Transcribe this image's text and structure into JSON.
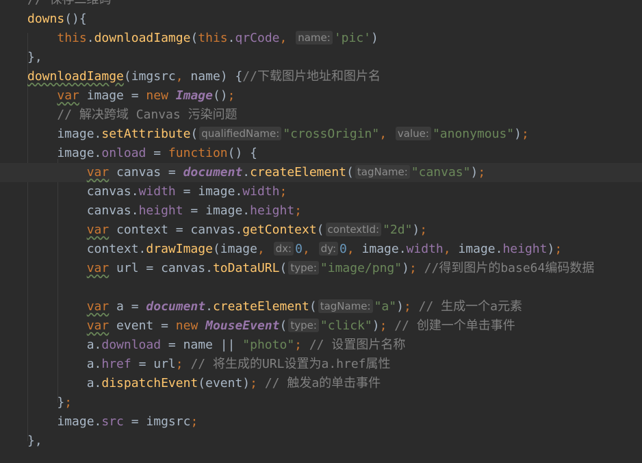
{
  "lines": [
    [
      {
        "c": "cmt",
        "t": "// 保存二维码"
      }
    ],
    [
      {
        "c": "fn",
        "t": "downs"
      },
      {
        "c": "",
        "t": "(){"
      }
    ],
    [
      {
        "c": "",
        "t": "    "
      },
      {
        "c": "kw",
        "t": "this"
      },
      {
        "c": "",
        "t": "."
      },
      {
        "c": "fn",
        "t": "downloadIamge"
      },
      {
        "c": "",
        "t": "("
      },
      {
        "c": "kw",
        "t": "this"
      },
      {
        "c": "",
        "t": "."
      },
      {
        "c": "prop",
        "t": "qrCode"
      },
      {
        "c": "kw",
        "t": ","
      },
      {
        "c": "",
        "t": " "
      },
      {
        "c": "hint",
        "t": "name:"
      },
      {
        "c": "str",
        "t": "'pic'"
      },
      {
        "c": "",
        "t": ")"
      }
    ],
    [
      {
        "c": "",
        "t": "},"
      }
    ],
    [
      {
        "c": "fn wavy",
        "t": "downloadIamge"
      },
      {
        "c": "",
        "t": "(imgsrc"
      },
      {
        "c": "kw",
        "t": ","
      },
      {
        "c": "",
        "t": " name) {"
      },
      {
        "c": "cmt",
        "t": "//"
      },
      {
        "c": "cmt cmt-cjk",
        "t": "下载图片地址和图片名"
      }
    ],
    [
      {
        "c": "",
        "t": "    "
      },
      {
        "c": "kw wavy",
        "t": "var"
      },
      {
        "c": "",
        "t": " image = "
      },
      {
        "c": "kw",
        "t": "new "
      },
      {
        "c": "cls",
        "t": "Image"
      },
      {
        "c": "",
        "t": "()"
      },
      {
        "c": "kw",
        "t": ";"
      }
    ],
    [
      {
        "c": "",
        "t": "    "
      },
      {
        "c": "cmt",
        "t": "// "
      },
      {
        "c": "cmt cmt-cjk",
        "t": "解决跨域"
      },
      {
        "c": "cmt",
        "t": " Canvas "
      },
      {
        "c": "cmt cmt-cjk",
        "t": "污染问题"
      }
    ],
    [
      {
        "c": "",
        "t": "    image."
      },
      {
        "c": "fn",
        "t": "setAttribute"
      },
      {
        "c": "",
        "t": "("
      },
      {
        "c": "hint",
        "t": "qualifiedName:"
      },
      {
        "c": "str",
        "t": "\"crossOrigin\""
      },
      {
        "c": "kw",
        "t": ","
      },
      {
        "c": "",
        "t": " "
      },
      {
        "c": "hint",
        "t": "value:"
      },
      {
        "c": "str",
        "t": "\"anonymous\""
      },
      {
        "c": "",
        "t": ")"
      },
      {
        "c": "kw",
        "t": ";"
      }
    ],
    [
      {
        "c": "",
        "t": "    image."
      },
      {
        "c": "prop",
        "t": "onload"
      },
      {
        "c": "",
        "t": " = "
      },
      {
        "c": "kw",
        "t": "function"
      },
      {
        "c": "",
        "t": "() {"
      }
    ],
    [
      {
        "c": "",
        "t": "        "
      },
      {
        "c": "kw wavy",
        "t": "var"
      },
      {
        "c": "",
        "t": " canvas = "
      },
      {
        "c": "cls",
        "t": "document"
      },
      {
        "c": "",
        "t": "."
      },
      {
        "c": "fn",
        "t": "createElement"
      },
      {
        "c": "",
        "t": "("
      },
      {
        "c": "hint",
        "t": "tagName:"
      },
      {
        "c": "str",
        "t": "\"canvas\""
      },
      {
        "c": "",
        "t": ")"
      },
      {
        "c": "kw",
        "t": ";"
      }
    ],
    [
      {
        "c": "",
        "t": "        canvas."
      },
      {
        "c": "prop",
        "t": "width"
      },
      {
        "c": "",
        "t": " = image."
      },
      {
        "c": "prop",
        "t": "width"
      },
      {
        "c": "kw",
        "t": ";"
      }
    ],
    [
      {
        "c": "",
        "t": "        canvas."
      },
      {
        "c": "prop",
        "t": "height"
      },
      {
        "c": "",
        "t": " = image."
      },
      {
        "c": "prop",
        "t": "height"
      },
      {
        "c": "kw",
        "t": ";"
      }
    ],
    [
      {
        "c": "",
        "t": "        "
      },
      {
        "c": "kw wavy",
        "t": "var"
      },
      {
        "c": "",
        "t": " context = canvas."
      },
      {
        "c": "fn",
        "t": "getContext"
      },
      {
        "c": "",
        "t": "("
      },
      {
        "c": "hint",
        "t": "contextId:"
      },
      {
        "c": "str",
        "t": "\"2d\""
      },
      {
        "c": "",
        "t": ")"
      },
      {
        "c": "kw",
        "t": ";"
      }
    ],
    [
      {
        "c": "",
        "t": "        context."
      },
      {
        "c": "fn",
        "t": "drawImage"
      },
      {
        "c": "",
        "t": "(image"
      },
      {
        "c": "kw",
        "t": ","
      },
      {
        "c": "",
        "t": " "
      },
      {
        "c": "hint",
        "t": "dx:"
      },
      {
        "c": "num",
        "t": "0"
      },
      {
        "c": "kw",
        "t": ","
      },
      {
        "c": "",
        "t": " "
      },
      {
        "c": "hint",
        "t": "dy:"
      },
      {
        "c": "num",
        "t": "0"
      },
      {
        "c": "kw",
        "t": ","
      },
      {
        "c": "",
        "t": " image."
      },
      {
        "c": "prop",
        "t": "width"
      },
      {
        "c": "kw",
        "t": ","
      },
      {
        "c": "",
        "t": " image."
      },
      {
        "c": "prop",
        "t": "height"
      },
      {
        "c": "",
        "t": ")"
      },
      {
        "c": "kw",
        "t": ";"
      }
    ],
    [
      {
        "c": "",
        "t": "        "
      },
      {
        "c": "kw wavy",
        "t": "var"
      },
      {
        "c": "",
        "t": " url = canvas."
      },
      {
        "c": "fn",
        "t": "toDataURL"
      },
      {
        "c": "",
        "t": "("
      },
      {
        "c": "hint",
        "t": "type:"
      },
      {
        "c": "str",
        "t": "\"image/png\""
      },
      {
        "c": "",
        "t": ")"
      },
      {
        "c": "kw",
        "t": ";"
      },
      {
        "c": "",
        "t": " "
      },
      {
        "c": "cmt",
        "t": "//"
      },
      {
        "c": "cmt cmt-cjk",
        "t": "得到图片的"
      },
      {
        "c": "cmt",
        "t": "base64"
      },
      {
        "c": "cmt cmt-cjk",
        "t": "编码数据"
      }
    ],
    [],
    [
      {
        "c": "",
        "t": "        "
      },
      {
        "c": "kw wavy",
        "t": "var"
      },
      {
        "c": "",
        "t": " a = "
      },
      {
        "c": "cls",
        "t": "document"
      },
      {
        "c": "",
        "t": "."
      },
      {
        "c": "fn",
        "t": "createElement"
      },
      {
        "c": "",
        "t": "("
      },
      {
        "c": "hint",
        "t": "tagName:"
      },
      {
        "c": "str",
        "t": "\"a\""
      },
      {
        "c": "",
        "t": ")"
      },
      {
        "c": "kw",
        "t": ";"
      },
      {
        "c": "",
        "t": " "
      },
      {
        "c": "cmt",
        "t": "// "
      },
      {
        "c": "cmt cmt-cjk",
        "t": "生成一个"
      },
      {
        "c": "cmt",
        "t": "a"
      },
      {
        "c": "cmt cmt-cjk",
        "t": "元素"
      }
    ],
    [
      {
        "c": "",
        "t": "        "
      },
      {
        "c": "kw wavy",
        "t": "var"
      },
      {
        "c": "",
        "t": " event = "
      },
      {
        "c": "kw",
        "t": "new "
      },
      {
        "c": "cls",
        "t": "MouseEvent"
      },
      {
        "c": "",
        "t": "("
      },
      {
        "c": "hint",
        "t": "type:"
      },
      {
        "c": "str",
        "t": "\"click\""
      },
      {
        "c": "",
        "t": ")"
      },
      {
        "c": "kw",
        "t": ";"
      },
      {
        "c": "",
        "t": " "
      },
      {
        "c": "cmt",
        "t": "// "
      },
      {
        "c": "cmt cmt-cjk",
        "t": "创建一个单击事件"
      }
    ],
    [
      {
        "c": "",
        "t": "        a."
      },
      {
        "c": "prop",
        "t": "download"
      },
      {
        "c": "",
        "t": " = name || "
      },
      {
        "c": "str",
        "t": "\"photo\""
      },
      {
        "c": "kw",
        "t": ";"
      },
      {
        "c": "",
        "t": " "
      },
      {
        "c": "cmt",
        "t": "// "
      },
      {
        "c": "cmt cmt-cjk",
        "t": "设置图片名称"
      }
    ],
    [
      {
        "c": "",
        "t": "        a."
      },
      {
        "c": "prop",
        "t": "href"
      },
      {
        "c": "",
        "t": " = url"
      },
      {
        "c": "kw",
        "t": ";"
      },
      {
        "c": "",
        "t": " "
      },
      {
        "c": "cmt",
        "t": "// "
      },
      {
        "c": "cmt cmt-cjk",
        "t": "将生成的"
      },
      {
        "c": "cmt",
        "t": "URL"
      },
      {
        "c": "cmt cmt-cjk",
        "t": "设置为"
      },
      {
        "c": "cmt",
        "t": "a.href"
      },
      {
        "c": "cmt cmt-cjk",
        "t": "属性"
      }
    ],
    [
      {
        "c": "",
        "t": "        a."
      },
      {
        "c": "fn",
        "t": "dispatchEvent"
      },
      {
        "c": "",
        "t": "(event)"
      },
      {
        "c": "kw",
        "t": ";"
      },
      {
        "c": "",
        "t": " "
      },
      {
        "c": "cmt",
        "t": "// "
      },
      {
        "c": "cmt cmt-cjk",
        "t": "触发"
      },
      {
        "c": "cmt",
        "t": "a"
      },
      {
        "c": "cmt cmt-cjk",
        "t": "的单击事件"
      }
    ],
    [
      {
        "c": "",
        "t": "    }"
      },
      {
        "c": "kw",
        "t": ";"
      }
    ],
    [
      {
        "c": "",
        "t": "    image."
      },
      {
        "c": "prop",
        "t": "src"
      },
      {
        "c": "",
        "t": " = imgsrc"
      },
      {
        "c": "kw",
        "t": ";"
      }
    ],
    [
      {
        "c": "",
        "t": "},"
      }
    ],
    []
  ],
  "current_line": 9,
  "colors": {
    "background": "#2b2b2b",
    "current_line": "#323232",
    "keyword": "#cc7832",
    "function": "#ffc66d",
    "property": "#9876aa",
    "string": "#6a8759",
    "number": "#6897bb",
    "comment": "#808080",
    "text": "#a9b7c6"
  }
}
